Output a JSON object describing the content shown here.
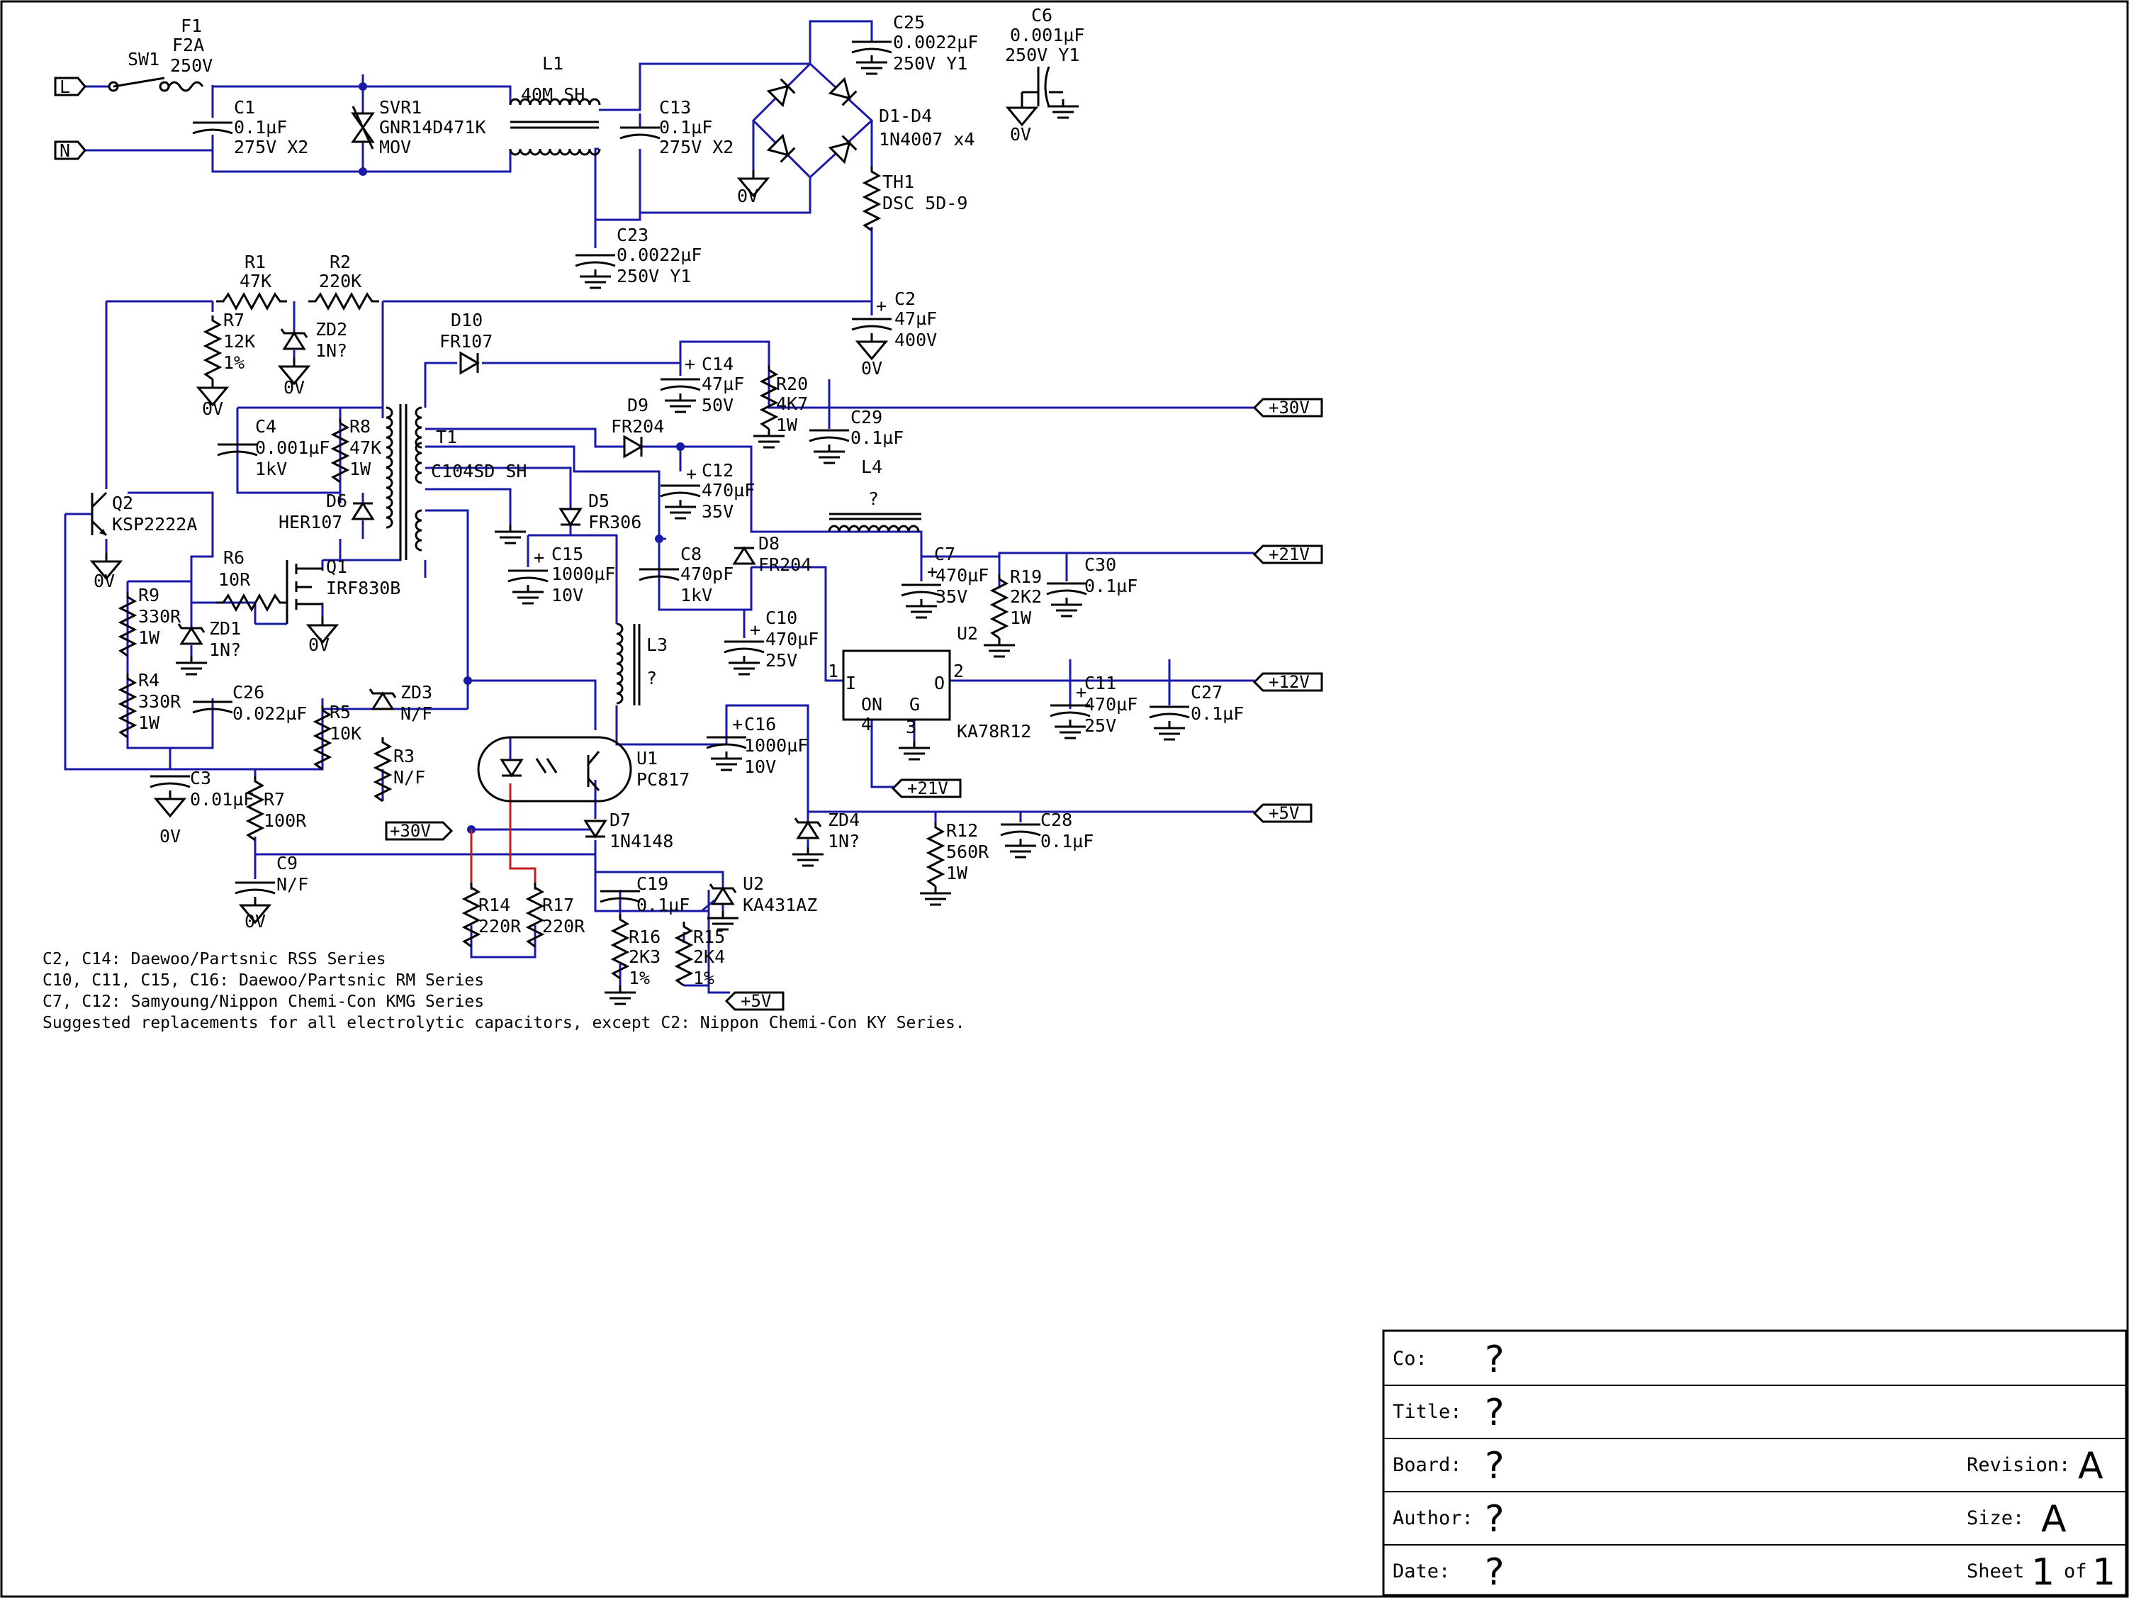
{
  "components": {
    "F1": [
      "F1",
      "F2A",
      "250V"
    ],
    "SW1": [
      "SW1"
    ],
    "C1": [
      "C1",
      "0.1µF",
      "275V X2"
    ],
    "SVR1": [
      "SVR1",
      "GNR14D471K",
      "MOV"
    ],
    "L1": [
      "L1",
      "40M SH"
    ],
    "C13": [
      "C13",
      "0.1µF",
      "275V X2"
    ],
    "C25": [
      "C25",
      "0.0022µF",
      "250V Y1"
    ],
    "C6": [
      "C6",
      "0.001µF",
      "250V Y1"
    ],
    "D1D4": [
      "D1-D4",
      "1N4007 x4"
    ],
    "TH1": [
      "TH1",
      "DSC 5D-9"
    ],
    "C23": [
      "C23",
      "0.0022µF",
      "250V Y1"
    ],
    "R1": [
      "R1",
      "47K"
    ],
    "R2": [
      "R2",
      "220K"
    ],
    "C2": [
      "C2",
      "47µF",
      "400V"
    ],
    "R7a": [
      "R7",
      "12K",
      "1%"
    ],
    "ZD2": [
      "ZD2",
      "1N?"
    ],
    "D10": [
      "D10",
      "FR107"
    ],
    "C14": [
      "C14",
      "47µF",
      "50V"
    ],
    "R20": [
      "R20",
      "4K7",
      "1W"
    ],
    "C29": [
      "C29",
      "0.1µF"
    ],
    "C4": [
      "C4",
      "0.001µF",
      "1kV"
    ],
    "R8": [
      "R8",
      "47K",
      "1W"
    ],
    "T1": [
      "T1",
      "C104SD SH"
    ],
    "D9": [
      "D9",
      "FR204"
    ],
    "C12": [
      "C12",
      "470µF",
      "35V"
    ],
    "L4": [
      "L4",
      "?"
    ],
    "Q2": [
      "Q2",
      "KSP2222A"
    ],
    "D6": [
      "D6",
      "HER107"
    ],
    "D5": [
      "D5",
      "FR306"
    ],
    "C15": [
      "C15",
      "1000µF",
      "10V"
    ],
    "C8": [
      "C8",
      "470pF",
      "1kV"
    ],
    "D8": [
      "D8",
      "FR204"
    ],
    "C7": [
      "C7",
      "470µF",
      "35V"
    ],
    "R19": [
      "R19",
      "2K2",
      "1W"
    ],
    "C30": [
      "C30",
      "0.1µF"
    ],
    "R6": [
      "R6",
      "10R"
    ],
    "Q1": [
      "Q1",
      "IRF830B"
    ],
    "R9": [
      "R9",
      "330R",
      "1W"
    ],
    "ZD1": [
      "ZD1",
      "1N?"
    ],
    "C10": [
      "C10",
      "470µF",
      "25V"
    ],
    "L3": [
      "L3",
      "?"
    ],
    "U2reg": [
      "U2",
      "KA78R12"
    ],
    "C11": [
      "C11",
      "470µF",
      "25V"
    ],
    "C27": [
      "C27",
      "0.1µF"
    ],
    "R4": [
      "R4",
      "330R",
      "1W"
    ],
    "C26": [
      "C26",
      "0.022µF"
    ],
    "R5": [
      "R5",
      "10K"
    ],
    "ZD3": [
      "ZD3",
      "N/F"
    ],
    "R3": [
      "R3",
      "N/F"
    ],
    "U1": [
      "U1",
      "PC817"
    ],
    "C16": [
      "C16",
      "1000µF",
      "10V"
    ],
    "C3": [
      "C3",
      "0.01µF"
    ],
    "R7b": [
      "R7",
      "100R"
    ],
    "D7": [
      "D7",
      "1N4148"
    ],
    "ZD4": [
      "ZD4",
      "1N?"
    ],
    "R12": [
      "R12",
      "560R",
      "1W"
    ],
    "C28": [
      "C28",
      "0.1µF"
    ],
    "C9": [
      "C9",
      "N/F"
    ],
    "R14": [
      "R14",
      "220R"
    ],
    "R17": [
      "R17",
      "220R"
    ],
    "C19": [
      "C19",
      "0.1µF"
    ],
    "U2ref": [
      "U2",
      "KA431AZ"
    ],
    "R16": [
      "R16",
      "2K3",
      "1%"
    ],
    "R15": [
      "R15",
      "2K4",
      "1%"
    ]
  },
  "pins": {
    "in": "I",
    "out": "O",
    "on": "ON",
    "gnd": "G",
    "p1": "1",
    "p2": "2",
    "p3": "3",
    "p4": "4"
  },
  "ground": "0V",
  "nets": {
    "L": "L",
    "N": "N",
    "v30": "+30V",
    "v21": "+21V",
    "v12": "+12V",
    "v5": "+5V"
  },
  "notes": [
    "C2, C14: Daewoo/Partsnic RSS Series",
    "C10, C11, C15, C16: Daewoo/Partsnic RM Series",
    "C7, C12: Samyoung/Nippon Chemi-Con KMG Series",
    "Suggested replacements for all electrolytic capacitors, except C2: Nippon Chemi-Con KY Series."
  ],
  "title_block": {
    "co_label": "Co:",
    "co_value": "?",
    "title_label": "Title:",
    "title_value": "?",
    "board_label": "Board:",
    "board_value": "?",
    "revision_label": "Revision:",
    "revision_value": "A",
    "author_label": "Author:",
    "author_value": "?",
    "size_label": "Size:",
    "size_value": "A",
    "date_label": "Date:",
    "date_value": "?",
    "sheet_label": "Sheet",
    "sheet_num": "1",
    "of_label": "of",
    "sheet_total": "1"
  },
  "colors": {
    "wire": "#1a1aa8",
    "led_wire": "#c41b1b",
    "ink": "#000000"
  }
}
